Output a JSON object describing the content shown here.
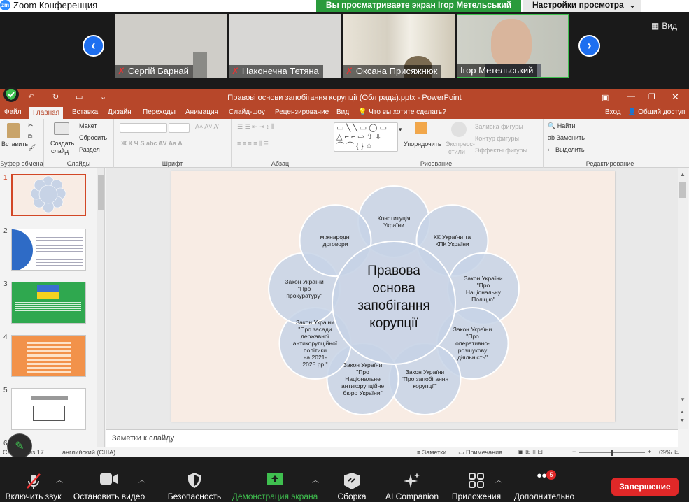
{
  "zoom": {
    "app_title": "Zoom Конференция",
    "logo": "zm",
    "viewing_banner": "Вы просматриваете экран Ігор Метельський",
    "view_settings": "Настройки просмотра",
    "view_button": "Вид",
    "participants": [
      {
        "name": "Сергій Барнай",
        "muted": true
      },
      {
        "name": "Наконечна Тетяна",
        "muted": true
      },
      {
        "name": "Оксана Присяжнюк",
        "muted": true
      },
      {
        "name": "Ігор Метельський",
        "muted": false
      }
    ],
    "toolbar": {
      "unmute": "Включить звук",
      "video": "Остановить видео",
      "security": "Безопасность",
      "share": "Демонстрация экрана",
      "whiteboard": "Сборка",
      "ai": "AI Companion",
      "apps": "Приложения",
      "more": "Дополнительно",
      "more_badge": "5",
      "end": "Завершение"
    }
  },
  "ppt": {
    "title": "Правові основи запобігання корупції (Обл рада).pptx - PowerPoint",
    "tabs": [
      "Файл",
      "Главная",
      "Вставка",
      "Дизайн",
      "Переходы",
      "Анимация",
      "Слайд-шоу",
      "Рецензирование",
      "Вид"
    ],
    "tell_me": "Что вы хотите сделать?",
    "login": "Вход",
    "share": "Общий доступ",
    "ribbon": {
      "paste": "Вставить",
      "clipboard": "Буфер обмена",
      "new_slide_1": "Создать",
      "new_slide_2": "слайд",
      "layout": "Макет",
      "reset": "Сбросить",
      "section": "Раздел",
      "slides": "Слайды",
      "font": "Шрифт",
      "paragraph": "Абзац",
      "arrange": "Упорядочить",
      "express_1": "Экспресс-",
      "express_2": "стили",
      "fill": "Заливка фигуры",
      "outline": "Контур фигуры",
      "effects": "Эффекты фигуры",
      "drawing": "Рисование",
      "find": "Найти",
      "replace": "Заменить",
      "select": "Выделить",
      "editing": "Редактирование"
    },
    "notes_placeholder": "Заметки к слайду",
    "status": {
      "slide_info": "Слайд 1 из 17",
      "language": "английский (США)",
      "notes": "Заметки",
      "comments": "Примечания",
      "zoom": "69%"
    },
    "slide_numbers": [
      "1",
      "2",
      "3",
      "4",
      "5",
      "6"
    ]
  },
  "slide": {
    "center": [
      "Правова",
      "основа",
      "запобігання",
      "корупції"
    ],
    "circles": [
      {
        "lines": [
          "Конституція",
          "України"
        ]
      },
      {
        "lines": [
          "КК України та",
          "КПК України"
        ]
      },
      {
        "lines": [
          "Закон України",
          "\"Про",
          "Національну",
          "Поліцію\""
        ]
      },
      {
        "lines": [
          "Закон України",
          "\"Про",
          "оперативно-",
          "розшукову",
          "діяльність\""
        ]
      },
      {
        "lines": [
          "Закон України",
          "\"Про запобігання",
          "корупції\""
        ]
      },
      {
        "lines": [
          "Закон України",
          "\"Про",
          "Національне",
          "антикорупційне",
          "бюро України\""
        ]
      },
      {
        "lines": [
          "Закон Украіни",
          "\"Про засади",
          "державної",
          "антикорупційної",
          "політики",
          "на 2021-",
          "2025 рр.\""
        ]
      },
      {
        "lines": [
          "Закон України",
          "\"Про",
          "прокуратуру\""
        ]
      },
      {
        "lines": [
          "міжнародні",
          "договори"
        ]
      }
    ]
  },
  "colors": {
    "zoom_green": "#2a9b3c",
    "ppt_red": "#b7472a",
    "end_red": "#e02828",
    "circle_fill": "#c7d3e6",
    "circle_stroke": "#ffffff"
  },
  "icons": [
    "zoom-logo",
    "mic-off-icon",
    "video-icon",
    "shield-icon",
    "share-screen-icon",
    "whiteboard-icon",
    "ai-sparkle-icon",
    "apps-icon",
    "more-icon",
    "pen-icon",
    "grid-icon",
    "chevron-left-icon",
    "chevron-right-icon"
  ]
}
